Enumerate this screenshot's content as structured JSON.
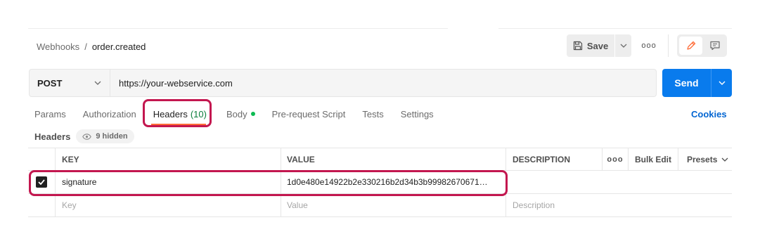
{
  "breadcrumb": {
    "parent": "Webhooks",
    "separator": "/",
    "current": "order.created"
  },
  "toolbar": {
    "save_label": "Save",
    "more": "ooo"
  },
  "request": {
    "method": "POST",
    "url": "https://your-webservice.com",
    "send_label": "Send"
  },
  "tabs": [
    {
      "label": "Params"
    },
    {
      "label": "Authorization"
    },
    {
      "label": "Headers",
      "count": "(10)"
    },
    {
      "label": "Body"
    },
    {
      "label": "Pre-request Script"
    },
    {
      "label": "Tests"
    },
    {
      "label": "Settings"
    }
  ],
  "cookies_label": "Cookies",
  "headers_section": {
    "title": "Headers",
    "hidden_label": "9 hidden"
  },
  "table": {
    "columns": {
      "key": "KEY",
      "value": "VALUE",
      "description": "DESCRIPTION",
      "more": "ooo",
      "bulk_edit": "Bulk Edit",
      "presets": "Presets"
    },
    "rows": [
      {
        "checked": true,
        "key": "signature",
        "value": "1d0e480e14922b2e330216b2d34b3b99982670671…",
        "description": ""
      }
    ],
    "placeholders": {
      "key": "Key",
      "value": "Value",
      "description": "Description"
    }
  },
  "colors": {
    "accent_send": "#097bed",
    "highlight": "#c3174f",
    "active_tab_underline": "#ff6c37",
    "cookies_link": "#0265d2",
    "body_dot": "#0cbb52"
  },
  "icons": [
    "save-icon",
    "chevron-down-icon",
    "pencil-icon",
    "comment-icon",
    "eye-icon",
    "check-icon"
  ]
}
